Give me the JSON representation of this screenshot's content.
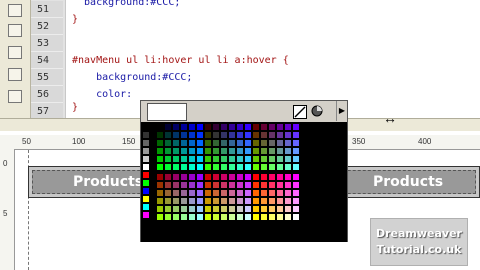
{
  "editor": {
    "lines": [
      {
        "num": "51",
        "text": "  background:#CCC;",
        "cls": "prop"
      },
      {
        "num": "52",
        "text": "}",
        "cls": "brace"
      },
      {
        "num": "53",
        "text": "",
        "cls": "prop"
      },
      {
        "num": "54",
        "text": "#navMenu ul li:hover ul li a:hover {",
        "cls": "sel"
      },
      {
        "num": "55",
        "text": "    background:#CCC;",
        "cls": "prop"
      },
      {
        "num": "56",
        "text": "    color:",
        "cls": "prop"
      },
      {
        "num": "57",
        "text": "}",
        "cls": "brace"
      }
    ]
  },
  "ruler": {
    "top_labels": [
      "50",
      "100",
      "150",
      "200",
      "250",
      "300",
      "350",
      "400"
    ],
    "left_labels": [
      "0",
      "5"
    ]
  },
  "design": {
    "nav_item_1": "Products",
    "nav_item_2": "Products"
  },
  "palette": {
    "preview_color": "#ffffff",
    "no_color_icon": "no-color-icon",
    "system_color_icon": "color-wheel-icon",
    "menu_arrow": "▶"
  },
  "watermark": {
    "line1": "Dreamweaver",
    "line2": "Tutorial.co.uk"
  },
  "cursor_glyph": "↔"
}
